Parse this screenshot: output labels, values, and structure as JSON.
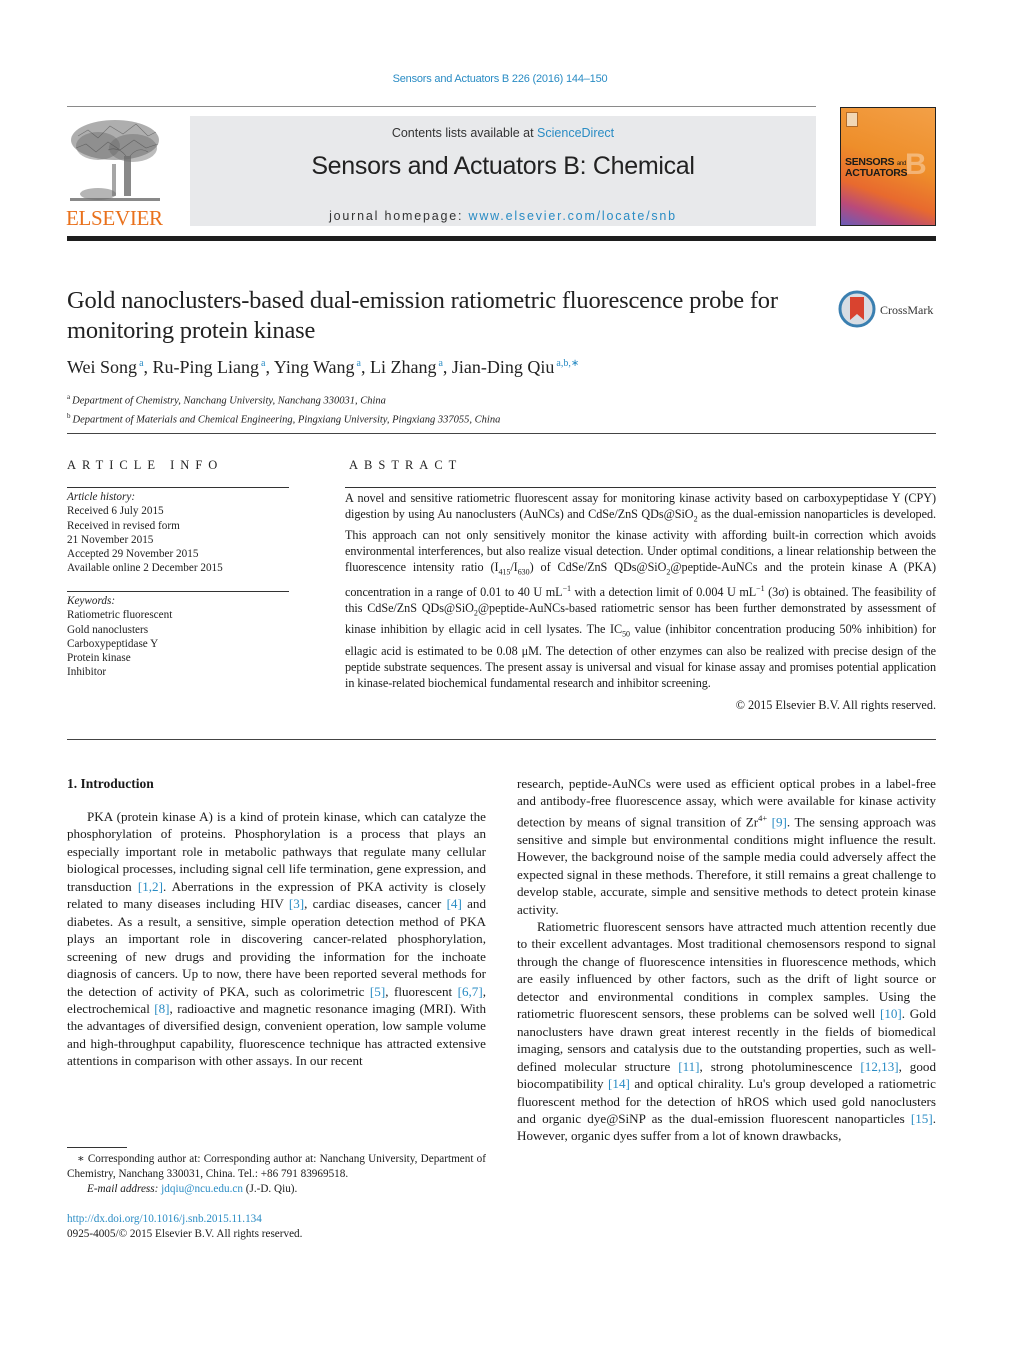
{
  "header": {
    "journal_ref": "Sensors and Actuators B 226 (2016) 144–150",
    "contents_prefix": "Contents lists available at ",
    "contents_link": "ScienceDirect",
    "journal_title": "Sensors and Actuators B: Chemical",
    "homepage_prefix": "journal homepage: ",
    "homepage_link": "www.elsevier.com/locate/snb",
    "publisher_logo_text": "ELSEVIER",
    "cover_line1": "SENSORS",
    "cover_line1_small": "and",
    "cover_line2": "ACTUATORS",
    "cover_letter": "B",
    "crossmark_label": "CrossMark"
  },
  "article": {
    "title": "Gold nanoclusters-based dual-emission ratiometric fluorescence probe for monitoring protein kinase",
    "authors": [
      {
        "name": "Wei Song",
        "sup": "a"
      },
      {
        "name": "Ru-Ping Liang",
        "sup": "a"
      },
      {
        "name": "Ying Wang",
        "sup": "a"
      },
      {
        "name": "Li Zhang",
        "sup": "a"
      },
      {
        "name": "Jian-Ding Qiu",
        "sup": "a,b,∗"
      }
    ],
    "affiliations": [
      {
        "key": "a",
        "text": "Department of Chemistry, Nanchang University, Nanchang 330031, China"
      },
      {
        "key": "b",
        "text": "Department of Materials and Chemical Engineering, Pingxiang University, Pingxiang 337055, China"
      }
    ]
  },
  "article_info": {
    "heading": "ARTICLE INFO",
    "history_label": "Article history:",
    "history": [
      "Received 6 July 2015",
      "Received in revised form",
      "21 November 2015",
      "Accepted 29 November 2015",
      "Available online 2 December 2015"
    ],
    "keywords_label": "Keywords:",
    "keywords": [
      "Ratiometric fluorescent",
      "Gold nanoclusters",
      "Carboxypeptidase Y",
      "Protein kinase",
      "Inhibitor"
    ]
  },
  "abstract": {
    "heading": "ABSTRACT",
    "parts": {
      "p1": "A novel and sensitive ratiometric fluorescent assay for monitoring kinase activity based on carboxypeptidase Y (CPY) digestion by using Au nanoclusters (AuNCs) and CdSe/ZnS QDs@SiO",
      "sub1": "2",
      "p2": " as the dual-emission nanoparticles is developed. This approach can not only sensitively monitor the kinase activity with affording built-in correction which avoids environmental interferences, but also realize visual detection. Under optimal conditions, a linear relationship between the fluorescence intensity ratio (I",
      "sub2": "415",
      "p3": "/I",
      "sub3": "630",
      "p4": ") of CdSe/ZnS QDs@SiO",
      "sub4": "2",
      "p5": "@peptide-AuNCs and the protein kinase A (PKA) concentration in a range of 0.01 to 40 U mL",
      "sup1": "−1",
      "p6": " with a detection limit of 0.004 U mL",
      "sup2": "−1",
      "p7": " (3σ) is obtained. The feasibility of this CdSe/ZnS QDs@SiO",
      "sub5": "2",
      "p8": "@peptide-AuNCs-based ratiometric sensor has been further demonstrated by assessment of kinase inhibition by ellagic acid in cell lysates. The IC",
      "sub6": "50",
      "p9": " value (inhibitor concentration producing 50% inhibition) for ellagic acid is estimated to be 0.08 μM. The detection of other enzymes can also be realized with precise design of the peptide substrate sequences. The present assay is universal and visual for kinase assay and promises potential application in kinase-related biochemical fundamental research and inhibitor screening."
    },
    "copyright": "© 2015 Elsevier B.V. All rights reserved."
  },
  "introduction": {
    "heading": "1.  Introduction",
    "left": {
      "t1": "PKA (protein kinase A) is a kind of protein kinase, which can catalyze the phosphorylation of proteins. Phosphorylation is a process that plays an especially important role in metabolic pathways that regulate many cellular biological processes, including signal cell life termination, gene expression, and transduction ",
      "r1": "[1,2]",
      "t2": ". Aberrations in the expression of PKA activity is closely related to many diseases including HIV ",
      "r2": "[3]",
      "t3": ", cardiac diseases, cancer ",
      "r3": "[4]",
      "t4": " and diabetes. As a result, a sensitive, simple operation detection method of PKA plays an important role in discovering cancer-related phosphorylation, screening of new drugs and providing the information for the inchoate diagnosis of cancers. Up to now, there have been reported several methods for the detection of activity of PKA, such as colorimetric ",
      "r4": "[5]",
      "t5": ", fluorescent ",
      "r5": "[6,7]",
      "t6": ", electrochemical ",
      "r6": "[8]",
      "t7": ", radioactive and magnetic resonance imaging (MRI). With the advantages of diversified design, convenient operation, low sample volume and high-throughput capability, fluorescence technique has attracted extensive attentions in comparison with other assays. In our recent"
    },
    "right": {
      "t1": "research, peptide-AuNCs were used as efficient optical probes in a label-free and antibody-free fluorescence assay, which were available for kinase activity detection by means of signal transition of Zr",
      "sup1": "4+",
      "t1b": " ",
      "r1": "[9]",
      "t2": ". The sensing approach was sensitive and simple but environmental conditions might influence the result. However, the background noise of the sample media could adversely affect the expected signal in these methods. Therefore, it still remains a great challenge to develop stable, accurate, simple and sensitive methods to detect protein kinase activity.",
      "p2_t1": "Ratiometric fluorescent sensors have attracted much attention recently due to their excellent advantages. Most traditional chemosensors respond to signal through the change of fluorescence intensities in fluorescence methods, which are easily influenced by other factors, such as the drift of light source or detector and environmental conditions in complex samples. Using the ratiometric fluorescent sensors, these problems can be solved well ",
      "p2_r1": "[10]",
      "p2_t2": ". Gold nanoclusters have drawn great interest recently in the fields of biomedical imaging, sensors and catalysis due to the outstanding properties, such as well-defined molecular structure ",
      "p2_r2": "[11]",
      "p2_t3": ", strong photoluminescence ",
      "p2_r3": "[12,13]",
      "p2_t4": ", good biocompatibility ",
      "p2_r4": "[14]",
      "p2_t5": " and optical chirality. Lu's group developed a ratiometric fluorescent method for the detection of hROS which used gold nanoclusters and organic dye@SiNP as the dual-emission fluorescent nanoparticles ",
      "p2_r5": "[15]",
      "p2_t6": ". However, organic dyes suffer from a lot of known drawbacks,"
    }
  },
  "footnote": {
    "star_text": "∗ Corresponding author at: Corresponding author at: Nanchang University, Department of Chemistry, Nanchang 330031, China. Tel.: +86 791 83969518.",
    "email_label": "E-mail address: ",
    "email": "jdqiu@ncu.edu.cn",
    "email_suffix": " (J.-D. Qiu).",
    "doi": "http://dx.doi.org/10.1016/j.snb.2015.11.134",
    "issn_copyright": "0925-4005/© 2015 Elsevier B.V. All rights reserved."
  },
  "colors": {
    "link": "#2a8cc4",
    "elsevier_orange": "#e9711c",
    "banner_bg": "#e8e9eb"
  }
}
